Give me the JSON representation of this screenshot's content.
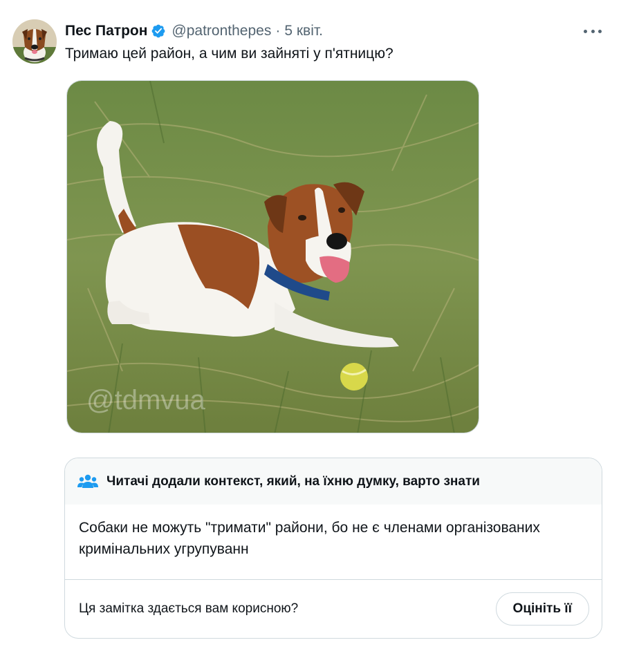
{
  "tweet": {
    "author_name": "Пес Патрон",
    "handle": "@patronthepes",
    "separator": "·",
    "time": "5 квіт.",
    "text": "Тримаю цей район, а чим ви зайняті у п'ятницю?",
    "verified_icon": "verified-badge-icon",
    "more_icon": "more-horizontal-icon",
    "image_watermark": "@tdmvua"
  },
  "community_note": {
    "title": "Читачі додали контекст, який, на їхню думку, варто знати",
    "body": "Собаки не можуть \"тримати\" райони, бо не є членами організованих кримінальних угрупуванн",
    "question": "Ця замітка здається вам корисною?",
    "rate_button": "Оцініть її",
    "icon": "people-icon"
  },
  "colors": {
    "accent": "#1d9bf0",
    "text_primary": "#0f1419",
    "text_secondary": "#536471",
    "border": "#cfd9de",
    "note_header_bg": "#f7f9f9"
  }
}
